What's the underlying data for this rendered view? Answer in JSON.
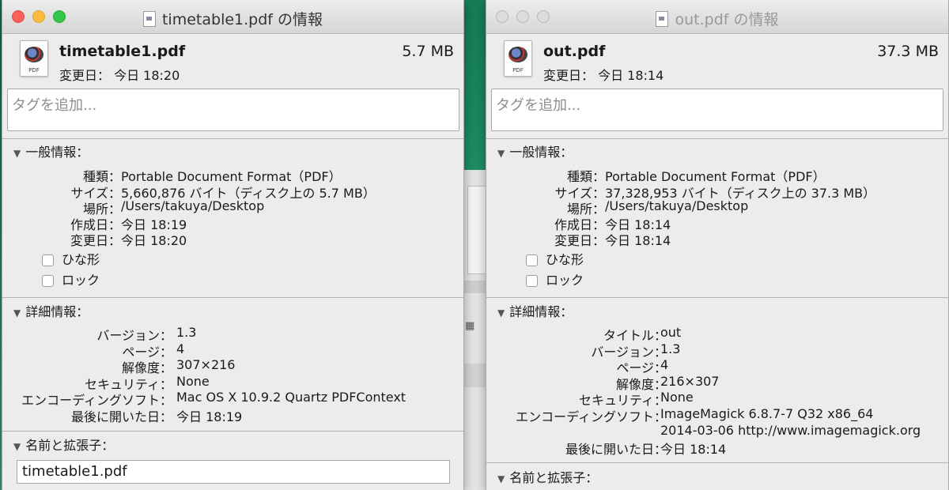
{
  "window1": {
    "title": "timetable1.pdf の情報",
    "file_name": "timetable1.pdf",
    "file_size": "5.7 MB",
    "modified": "変更日： 今日 18:20",
    "icon_label": "PDF",
    "tags_placeholder": "タグを追加...",
    "general": {
      "heading": "一般情報：",
      "rows": [
        {
          "key": "種類：",
          "value": "Portable Document Format（PDF）"
        },
        {
          "key": "サイズ：",
          "value": "5,660,876 バイト（ディスク上の 5.7 MB）"
        },
        {
          "key": "場所：",
          "value": "/Users/takuya/Desktop"
        },
        {
          "key": "作成日：",
          "value": "今日 18:19"
        },
        {
          "key": "変更日：",
          "value": "今日 18:20"
        }
      ],
      "stationery_label": "ひな形",
      "locked_label": "ロック"
    },
    "more": {
      "heading": "詳細情報：",
      "rows": [
        {
          "key": "バージョン：",
          "value": "1.3"
        },
        {
          "key": "ページ：",
          "value": "4"
        },
        {
          "key": "解像度：",
          "value": "307×216"
        },
        {
          "key": "セキュリティ：",
          "value": "None"
        },
        {
          "key": "エンコーディングソフト：",
          "value": "Mac OS X 10.9.2 Quartz PDFContext"
        },
        {
          "key": "最後に開いた日：",
          "value": "今日 18:19"
        }
      ]
    },
    "name_ext": {
      "heading": "名前と拡張子：",
      "value": "timetable1.pdf"
    }
  },
  "window2": {
    "title": "out.pdf の情報",
    "file_name": "out.pdf",
    "file_size": "37.3 MB",
    "modified": "変更日： 今日 18:14",
    "icon_label": "PDF",
    "tags_placeholder": "タグを追加...",
    "general": {
      "heading": "一般情報：",
      "rows": [
        {
          "key": "種類：",
          "value": "Portable Document Format（PDF）"
        },
        {
          "key": "サイズ：",
          "value": "37,328,953 バイト（ディスク上の 37.3 MB）"
        },
        {
          "key": "場所：",
          "value": "/Users/takuya/Desktop"
        },
        {
          "key": "作成日：",
          "value": "今日 18:14"
        },
        {
          "key": "変更日：",
          "value": "今日 18:14"
        }
      ],
      "stationery_label": "ひな形",
      "locked_label": "ロック"
    },
    "more": {
      "heading": "詳細情報：",
      "rows": [
        {
          "key": "タイトル：",
          "value": "out"
        },
        {
          "key": "バージョン：",
          "value": "1.3"
        },
        {
          "key": "ページ：",
          "value": "4"
        },
        {
          "key": "解像度：",
          "value": "216×307"
        },
        {
          "key": "セキュリティ：",
          "value": "None"
        },
        {
          "key": "エンコーディングソフト：",
          "value": "ImageMagick 6.8.7-7 Q32 x86_64"
        },
        {
          "key": "",
          "value": "2014-03-06 http://www.imagemagick.org"
        },
        {
          "key": "最後に開いた日：",
          "value": "今日 18:14"
        }
      ]
    },
    "name_ext": {
      "heading": "名前と拡張子："
    }
  },
  "colors": {
    "close": "#fc605c",
    "minimize": "#fdbc40",
    "zoom": "#34c84a",
    "desktop": "#1a8a5f"
  }
}
